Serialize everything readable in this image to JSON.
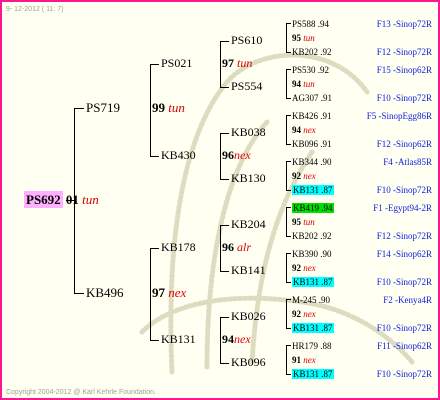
{
  "header": {
    "date": "9- 12-2012 ( 11: 7)"
  },
  "footer": {
    "copyright": "Copyright 2004-2012 @ Karl Kehrle Foundation."
  },
  "root": {
    "code": "PS692",
    "year": "01",
    "race": "tun"
  },
  "gen1": {
    "sire": {
      "code": "PS719",
      "year": "99",
      "race": "tun"
    },
    "dam": {
      "code": "KB496",
      "year": "97",
      "race": "nex"
    }
  },
  "gen2": [
    {
      "code": "PS021",
      "year": "97",
      "race": "tun"
    },
    {
      "code": "KB430",
      "year": "96",
      "race": "nex"
    },
    {
      "code": "KB178",
      "year": "96",
      "race": "alr"
    },
    {
      "code": "KB131",
      "year": "94",
      "race": "nex"
    }
  ],
  "gen3": [
    {
      "code": "PS610",
      "year": "95",
      "race": "tun"
    },
    {
      "code": "PS554",
      "year": "94",
      "race": "tun"
    },
    {
      "code": "KB038",
      "year": "94",
      "race": "nex"
    },
    {
      "code": "KB130",
      "year": "92",
      "race": "nex"
    },
    {
      "code": "KB204",
      "year": "95",
      "race": "tun"
    },
    {
      "code": "KB141",
      "year": "92",
      "race": "nex"
    },
    {
      "code": "KB026",
      "year": "92",
      "race": "nex"
    },
    {
      "code": "KB096",
      "year": "91",
      "race": "nex"
    }
  ],
  "gen4": [
    {
      "code": "PS588",
      "year": ".94",
      "line": "F13 -Sinop72R"
    },
    {
      "code": "KB202",
      "year": ".92",
      "line": "F12 -Sinop72R"
    },
    {
      "code": "PS530",
      "year": ".92",
      "line": "F15 -Sinop62R"
    },
    {
      "code": "AG307",
      "year": ".91",
      "line": "F10 -Sinop72R"
    },
    {
      "code": "KB426",
      "year": ".91",
      "line": "F5 -SinopEgg86R"
    },
    {
      "code": "KB096",
      "year": ".91",
      "line": "F12 -Sinop62R"
    },
    {
      "code": "KB344",
      "year": ".90",
      "line": "F4 -Atlas85R"
    },
    {
      "code": "KB131",
      "year": ".87",
      "line": "F10 -Sinop72R"
    },
    {
      "code": "KB419",
      "year": ".94",
      "line": "F1 -Egypt94-2R"
    },
    {
      "code": "KB202",
      "year": ".92",
      "line": "F12 -Sinop72R"
    },
    {
      "code": "KB390",
      "year": ".90",
      "line": "F14 -Sinop62R"
    },
    {
      "code": "KB131",
      "year": ".87",
      "line": "F10 -Sinop72R"
    },
    {
      "code": "M-245",
      "year": ".90",
      "line": "F2 -Kenya4R"
    },
    {
      "code": "KB131",
      "year": ".87",
      "line": "F10 -Sinop72R"
    },
    {
      "code": "HR179",
      "year": ".88",
      "line": "F11 -Sinop62R"
    },
    {
      "code": "KB131",
      "year": ".87",
      "line": "F10 -Sinop72R"
    }
  ]
}
